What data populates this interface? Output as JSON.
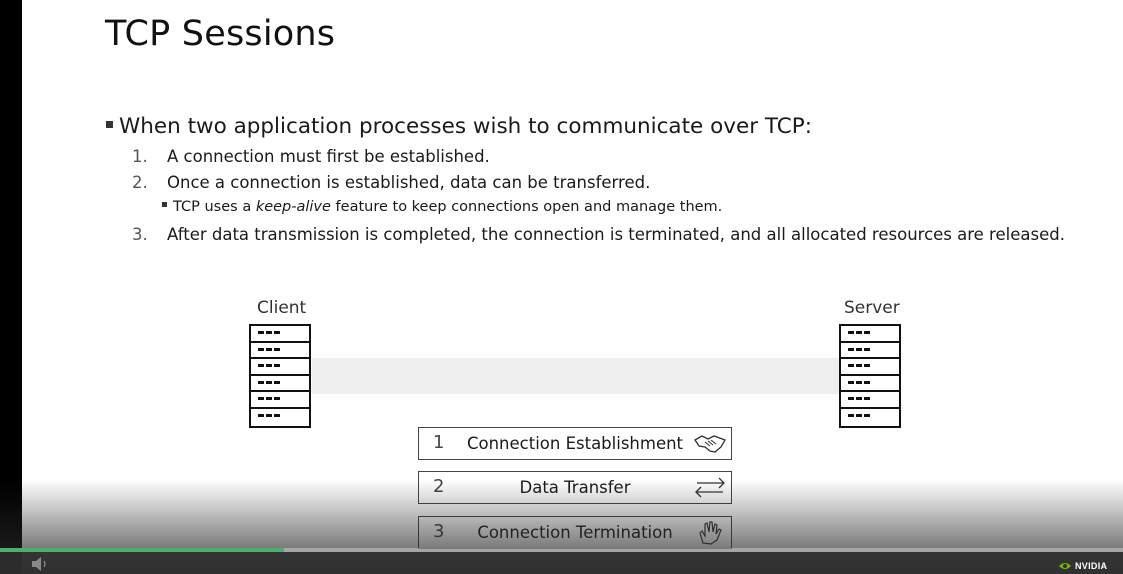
{
  "slide": {
    "title": "TCP Sessions",
    "bullet": "When two application processes wish to communicate over TCP:",
    "items": [
      {
        "num": "1.",
        "text": "A connection must first be established."
      },
      {
        "num": "2.",
        "text": "Once a connection is established, data can be transferred."
      },
      {
        "num": "3.",
        "text": "After data transmission is completed, the connection is terminated, and all allocated resources are released."
      }
    ],
    "subbullet": {
      "prefix": "TCP uses a ",
      "emphasis": "keep-alive",
      "suffix": " feature to keep connections open and manage them."
    }
  },
  "diagram": {
    "client_label": "Client",
    "server_label": "Server",
    "steps": [
      {
        "num": "1",
        "label": "Connection Establishment",
        "icon": "handshake-icon"
      },
      {
        "num": "2",
        "label": "Data Transfer",
        "icon": "bidirectional-arrows-icon"
      },
      {
        "num": "3",
        "label": "Connection Termination",
        "icon": "waving-hand-icon"
      }
    ]
  },
  "player": {
    "progress_fraction": 0.253,
    "progress_color": "#4caf6e",
    "brand": "NVIDIA",
    "brand_color": "#76b900"
  }
}
